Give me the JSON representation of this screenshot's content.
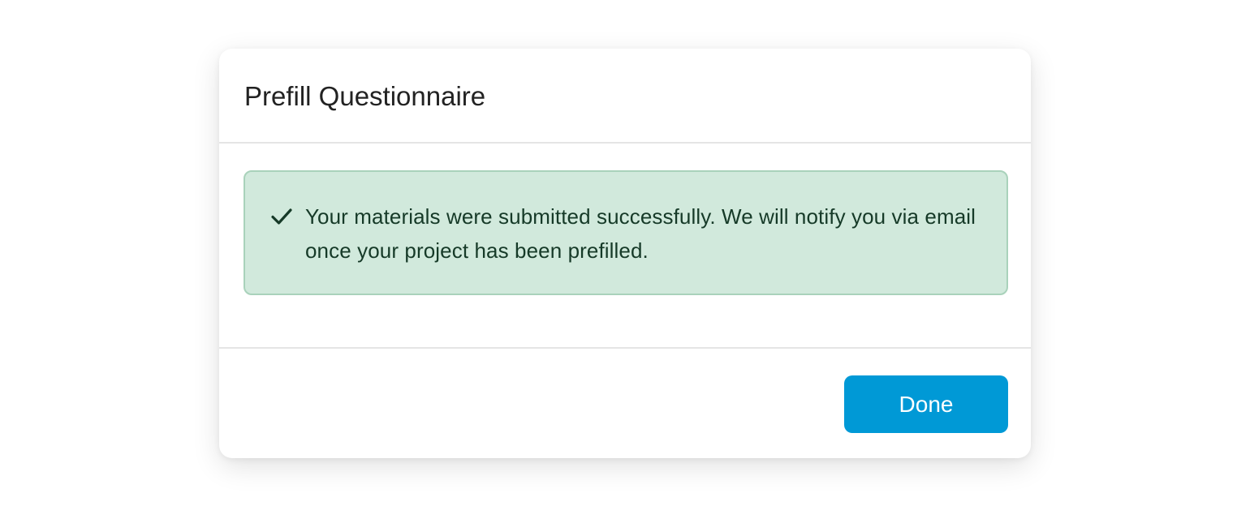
{
  "modal": {
    "title": "Prefill Questionnaire",
    "alert": {
      "icon": "check-icon",
      "message": "Your materials were submitted successfully. We will notify you via email once your project has been prefilled."
    },
    "footer": {
      "done_label": "Done"
    }
  },
  "colors": {
    "alert_background": "#d1e9dc",
    "alert_border": "#a9d2bb",
    "alert_text": "#163a28",
    "primary_button": "#0099d6",
    "title_text": "#222222"
  }
}
